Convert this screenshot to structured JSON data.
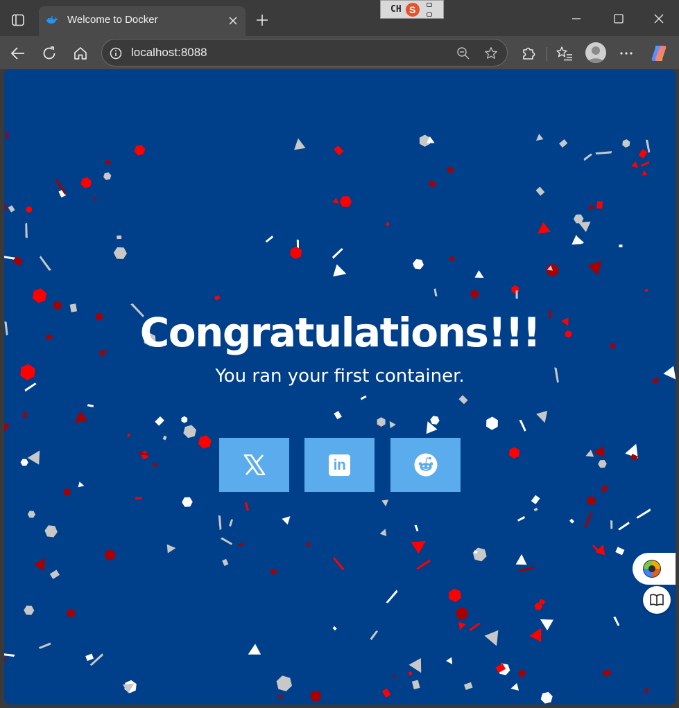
{
  "window": {
    "tab_title": "Welcome to Docker",
    "ime_label": "CH",
    "ime_logo": "S"
  },
  "toolbar": {
    "url": "localhost:8088"
  },
  "page": {
    "heading": "Congratulations!!!",
    "subheading": "You ran your first container.",
    "share_buttons": [
      {
        "name": "x",
        "icon": "x-logo-icon"
      },
      {
        "name": "linkedin",
        "icon": "linkedin-logo-icon",
        "label": "in"
      },
      {
        "name": "reddit",
        "icon": "reddit-logo-icon"
      }
    ]
  },
  "colors": {
    "background": "#00408a",
    "share_button": "#5aacec",
    "confetti": [
      "#ff0000",
      "#a80000",
      "#ffffff",
      "#c8c8c8"
    ]
  }
}
